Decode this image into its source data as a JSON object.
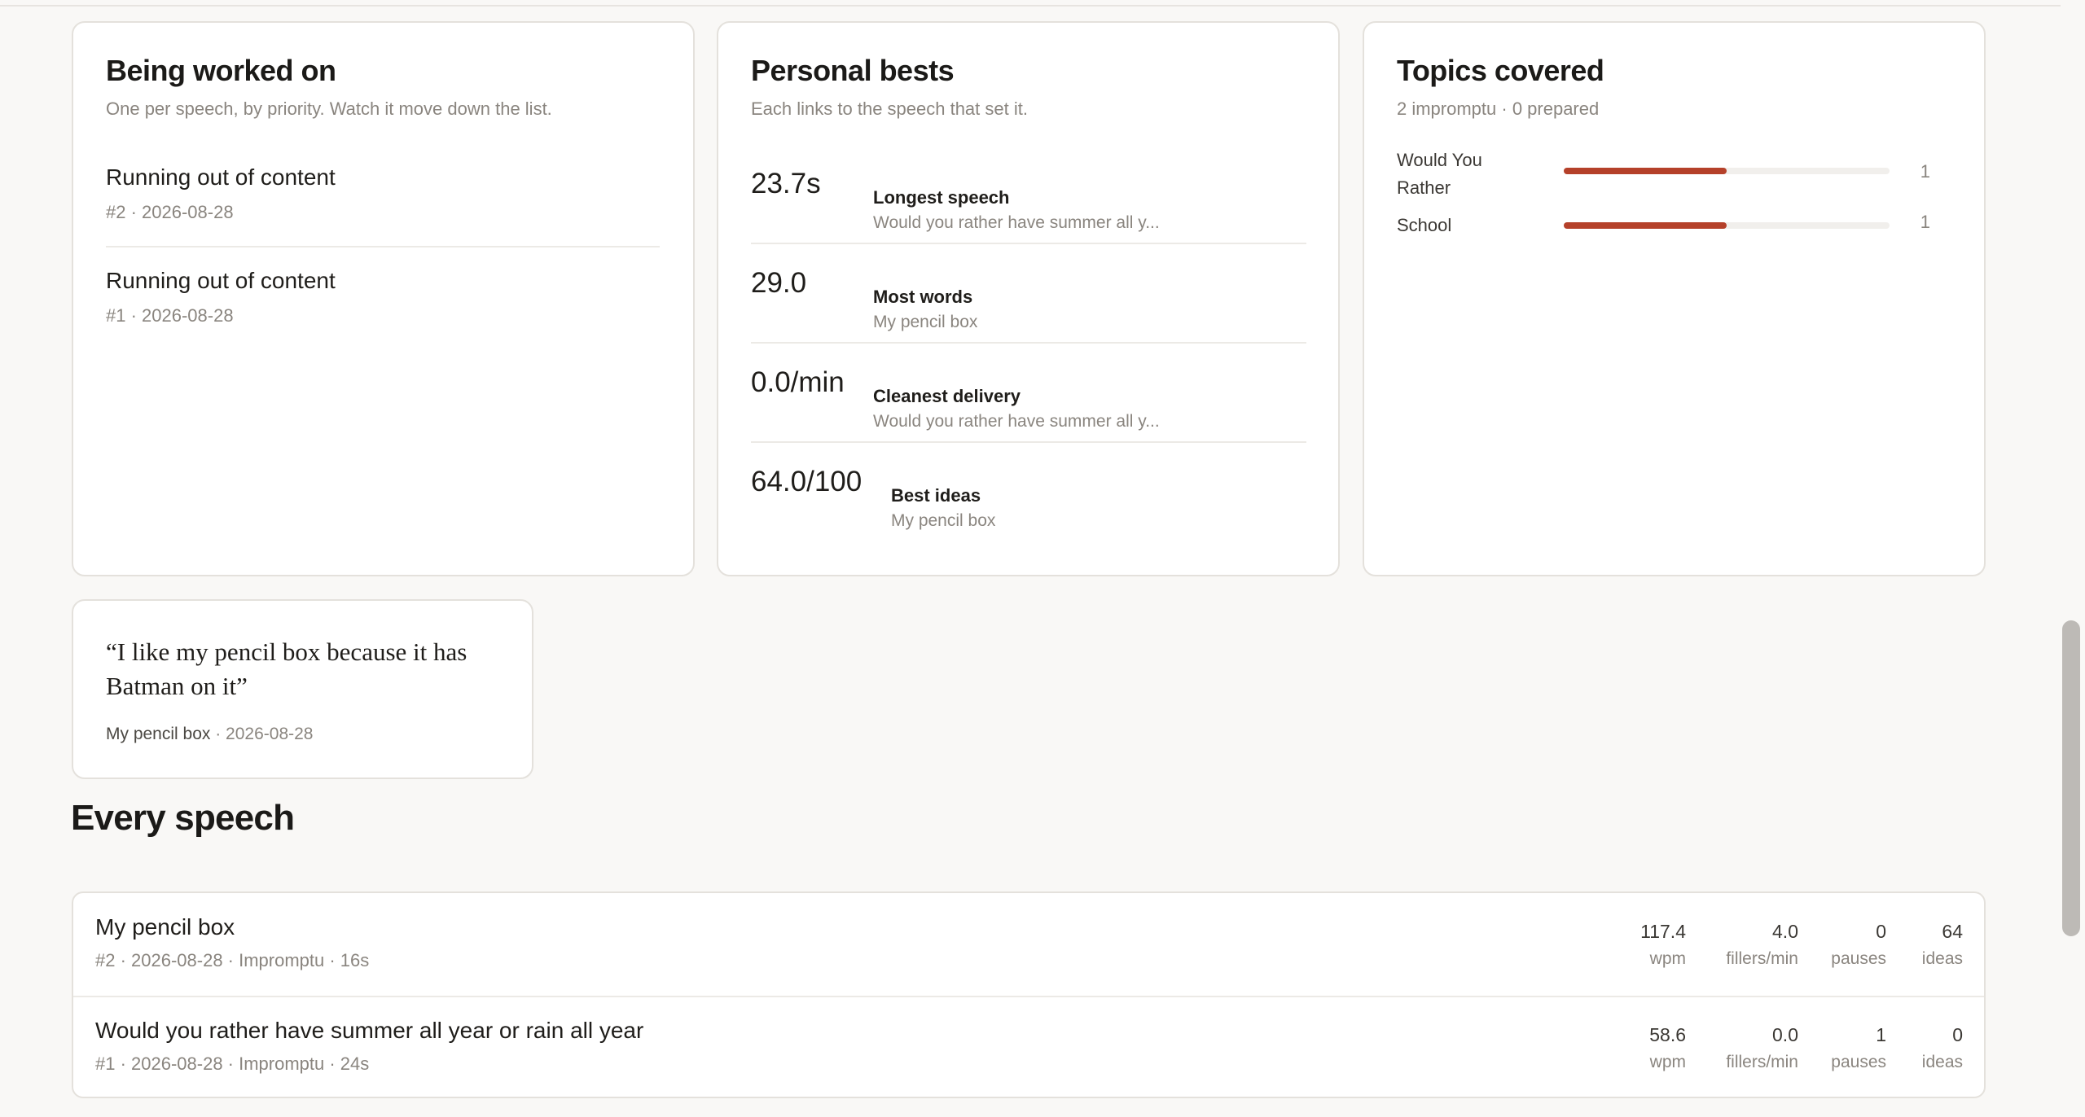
{
  "being_worked_on": {
    "title": "Being worked on",
    "subtitle": "One per speech, by priority. Watch it move down the list.",
    "items": [
      {
        "title": "Running out of content",
        "meta": "#2 · 2026-08-28"
      },
      {
        "title": "Running out of content",
        "meta": "#1 · 2026-08-28"
      }
    ]
  },
  "personal_bests": {
    "title": "Personal bests",
    "subtitle": "Each links to the speech that set it.",
    "items": [
      {
        "value": "23.7s",
        "label": "Longest speech",
        "speech": "Would you rather have summer all y..."
      },
      {
        "value": "29.0",
        "label": "Most words",
        "speech": "My pencil box"
      },
      {
        "value": "0.0/min",
        "label": "Cleanest delivery",
        "speech": "Would you rather have summer all y..."
      },
      {
        "value": "64.0/100",
        "label": "Best ideas",
        "speech": "My pencil box"
      }
    ]
  },
  "topics": {
    "title": "Topics covered",
    "subtitle": "2 impromptu · 0 prepared",
    "accent": "#b5412a",
    "items": [
      {
        "name": "Would You Rather",
        "count": "1",
        "fraction": 0.5
      },
      {
        "name": "School",
        "count": "1",
        "fraction": 0.5
      }
    ]
  },
  "quote": {
    "text": "“I like my pencil box because it has Batman on it”",
    "source": "My pencil box",
    "date": "· 2026-08-28"
  },
  "every_speech": {
    "title": "Every speech",
    "rows": [
      {
        "title": "My pencil box",
        "meta": "#2 · 2026-08-28 · Impromptu · 16s",
        "wpm": "117.4",
        "fillers": "4.0",
        "pauses": "0",
        "ideas": "64"
      },
      {
        "title": "Would you rather have summer all year or rain all year",
        "meta": "#1 · 2026-08-28 · Impromptu · 24s",
        "wpm": "58.6",
        "fillers": "0.0",
        "pauses": "1",
        "ideas": "0"
      }
    ],
    "units": {
      "wpm": "wpm",
      "fillers": "fillers/min",
      "pauses": "pauses",
      "ideas": "ideas"
    }
  }
}
